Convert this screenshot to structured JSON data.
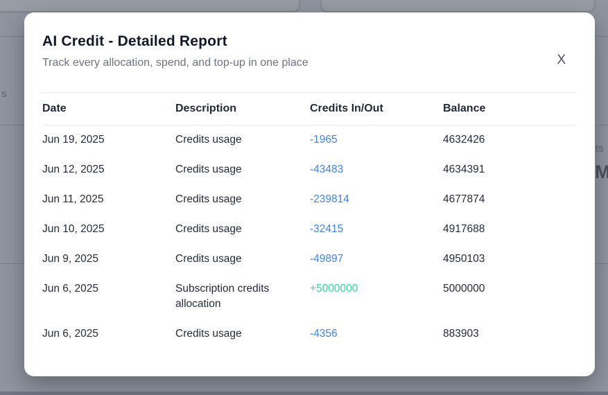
{
  "modal": {
    "title": "AI Credit - Detailed Report",
    "subtitle": "Track every allocation, spend, and top-up in one place",
    "close_label": "X"
  },
  "table": {
    "columns": [
      "Date",
      "Description",
      "Credits In/Out",
      "Balance"
    ],
    "rows": [
      {
        "date": "Jun 19, 2025",
        "description": "Credits usage",
        "credits": "-1965",
        "balance": "4632426"
      },
      {
        "date": "Jun 12, 2025",
        "description": "Credits usage",
        "credits": "-43483",
        "balance": "4634391"
      },
      {
        "date": "Jun 11, 2025",
        "description": "Credits usage",
        "credits": "-239814",
        "balance": "4677874"
      },
      {
        "date": "Jun 10, 2025",
        "description": "Credits usage",
        "credits": "-32415",
        "balance": "4917688"
      },
      {
        "date": "Jun 9, 2025",
        "description": "Credits usage",
        "credits": "-49897",
        "balance": "4950103"
      },
      {
        "date": "Jun 6, 2025",
        "description": "Subscription credits allocation",
        "credits": "+5000000",
        "balance": "5000000"
      },
      {
        "date": "Jun 6, 2025",
        "description": "Credits usage",
        "credits": "-4356",
        "balance": "883903"
      }
    ]
  },
  "colors": {
    "debit_text": "#3b82f6",
    "credit_text": "#2fd7a4"
  },
  "backdrop": {
    "left_text_fragment": "s",
    "right_text_fragment": "ts",
    "right_bold_fragment": "M"
  }
}
